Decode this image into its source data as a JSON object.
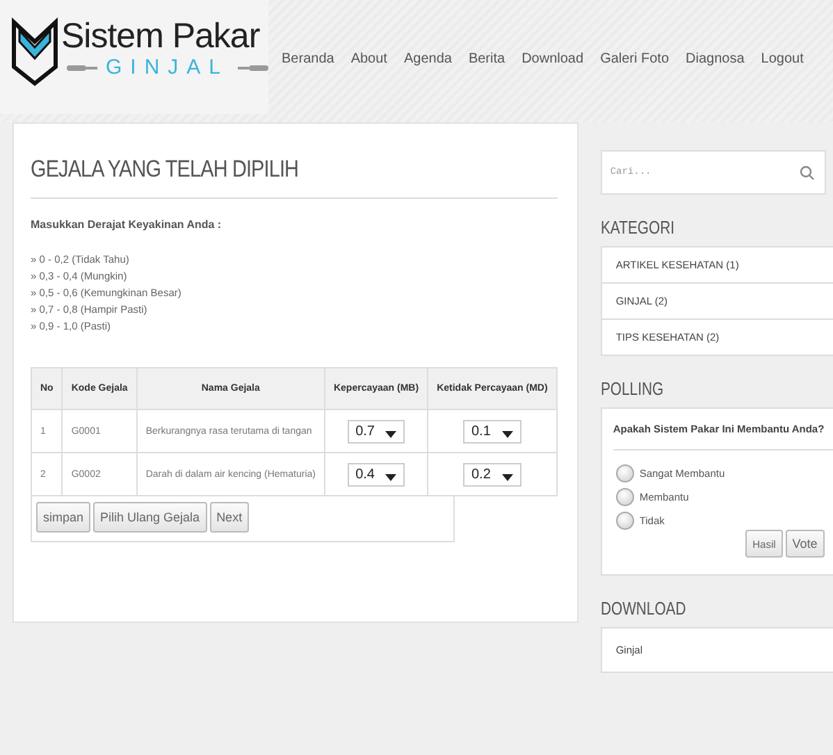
{
  "logo": {
    "title": "Sistem Pakar",
    "subtitle": "GINJAL"
  },
  "nav": [
    "Beranda",
    "About",
    "Agenda",
    "Berita",
    "Download",
    "Galeri Foto",
    "Diagnosa",
    "Logout"
  ],
  "main": {
    "title": "GEJALA YANG TELAH DIPILIH",
    "instruction": "Masukkan Derajat Keyakinan Anda :",
    "scale": [
      "» 0 - 0,2 (Tidak Tahu)",
      "» 0,3 - 0,4 (Mungkin)",
      "» 0,5 - 0,6 (Kemungkinan Besar)",
      "» 0,7 - 0,8 (Hampir Pasti)",
      "» 0,9 - 1,0 (Pasti)"
    ],
    "table": {
      "columns": [
        "No",
        "Kode Gejala",
        "Nama Gejala",
        "Kepercayaan (MB)",
        "Ketidak Percayaan (MD)"
      ],
      "rows": [
        {
          "no": "1",
          "code": "G0001",
          "name": "Berkurangnya rasa terutama di tangan",
          "mb": "0.7",
          "md": "0.1"
        },
        {
          "no": "2",
          "code": "G0002",
          "name": "Darah di dalam air kencing (Hematuria)",
          "mb": "0.4",
          "md": "0.2"
        }
      ]
    },
    "buttons": [
      "simpan",
      "Pilih Ulang Gejala",
      "Next"
    ]
  },
  "sidebar": {
    "search": {
      "placeholder": "Cari..."
    },
    "kategori": {
      "title": "KATEGORI",
      "items": [
        "ARTIKEL KESEHATAN (1)",
        "GINJAL (2)",
        "TIPS KESEHATAN (2)"
      ]
    },
    "polling": {
      "title": "POLLING",
      "question": "Apakah Sistem Pakar Ini Membantu Anda?",
      "options": [
        {
          "label": "Sangat Membantu",
          "selected": false
        },
        {
          "label": "Membantu",
          "selected": false
        },
        {
          "label": "Tidak",
          "selected": false
        }
      ],
      "buttons": [
        "Hasil",
        "Vote"
      ]
    },
    "download": {
      "title": "DOWNLOAD",
      "items": [
        "Ginjal"
      ]
    }
  }
}
